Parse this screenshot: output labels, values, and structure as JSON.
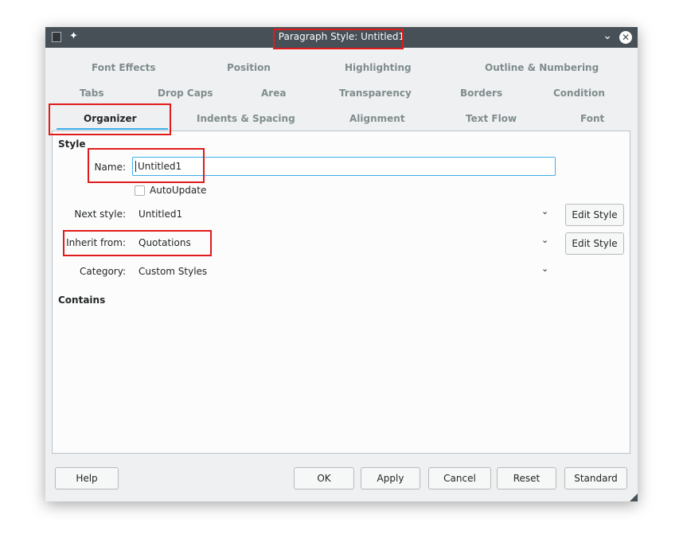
{
  "window": {
    "title": "Paragraph Style: Untitled1",
    "pin_glyph": "✦",
    "minimize_glyph": "⌄",
    "close_glyph": "✕"
  },
  "tabs": {
    "row1": [
      "Font Effects",
      "Position",
      "Highlighting",
      "Outline & Numbering"
    ],
    "row2": [
      "Tabs",
      "Drop Caps",
      "Area",
      "Transparency",
      "Borders",
      "Condition"
    ],
    "row3": [
      "Organizer",
      "Indents & Spacing",
      "Alignment",
      "Text Flow",
      "Font"
    ],
    "active": "Organizer"
  },
  "style": {
    "section_label": "Style",
    "name_label": "Name:",
    "name_value": "Untitled1",
    "autoupdate_label": "AutoUpdate",
    "autoupdate_checked": false,
    "next_style_label": "Next style:",
    "next_style_value": "Untitled1",
    "inherit_label": "Inherit from:",
    "inherit_value": "Quotations",
    "category_label": "Category:",
    "category_value": "Custom Styles",
    "edit_style_label": "Edit Style",
    "dropdown_glyph": "⌄"
  },
  "contains": {
    "section_label": "Contains"
  },
  "buttons": {
    "help": "Help",
    "ok": "OK",
    "apply": "Apply",
    "cancel": "Cancel",
    "reset": "Reset",
    "standard": "Standard"
  },
  "colors": {
    "titlebar": "#475057",
    "accent": "#3daee9",
    "highlight": "#e01b1b"
  }
}
